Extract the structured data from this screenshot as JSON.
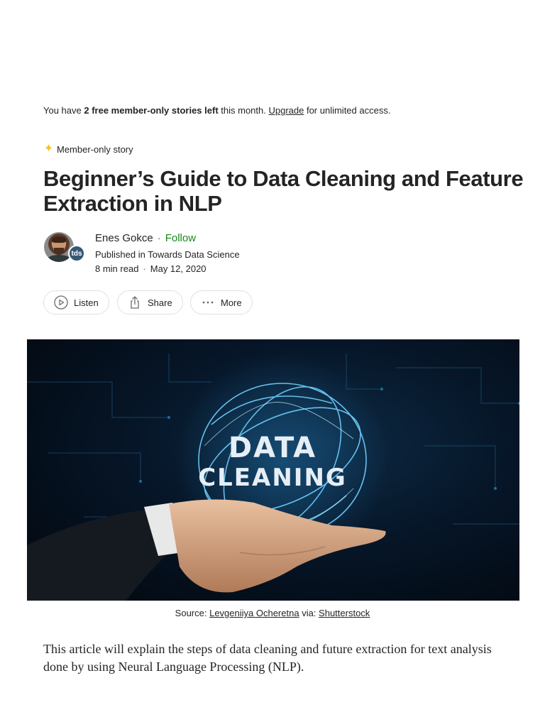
{
  "notice": {
    "prefix": "You have ",
    "bold": "2 free member-only stories left",
    "middle": " this month. ",
    "link": "Upgrade",
    "suffix": " for unlimited access."
  },
  "badge": {
    "label": "Member-only story",
    "icon": "sparkle-icon",
    "color": "#ffc017"
  },
  "article": {
    "title": "Beginner’s Guide to Data Cleaning and Feature Extraction in NLP",
    "author": "Enes Gokce",
    "follow": "Follow",
    "published_prefix": "Published in",
    "publication": "Towards Data Science",
    "publication_badge": "tds",
    "read_time": "8 min read",
    "date": "May 12, 2020"
  },
  "actions": {
    "listen": "Listen",
    "share": "Share",
    "more": "More"
  },
  "hero": {
    "line1": "DATA",
    "line2": "CLEANING"
  },
  "caption": {
    "prefix": "Source: ",
    "author_link": "Levgeniiya Ocheretna",
    "via": " via: ",
    "source_link": "Shutterstock"
  },
  "body": {
    "paragraph": "This article will explain the steps of data cleaning and future extraction for text analysis done by using Neural Language Processing (NLP)."
  },
  "colors": {
    "follow": "#1a8917",
    "text": "#242424",
    "badge_bg": "#355876"
  }
}
